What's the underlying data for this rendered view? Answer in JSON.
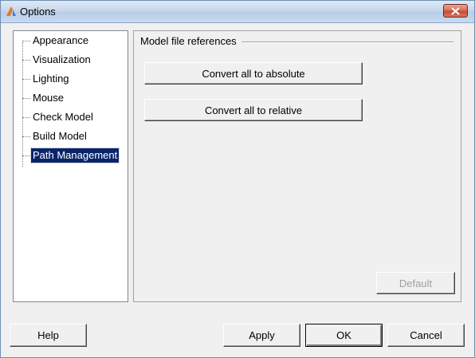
{
  "window": {
    "title": "Options",
    "close_icon": "close-icon"
  },
  "sidebar": {
    "items": [
      {
        "label": "Appearance",
        "selected": false
      },
      {
        "label": "Visualization",
        "selected": false
      },
      {
        "label": "Lighting",
        "selected": false
      },
      {
        "label": "Mouse",
        "selected": false
      },
      {
        "label": "Check Model",
        "selected": false
      },
      {
        "label": "Build Model",
        "selected": false
      },
      {
        "label": "Path Management",
        "selected": true
      }
    ]
  },
  "main": {
    "group_title": "Model file references",
    "convert_absolute_label": "Convert all to absolute",
    "convert_relative_label": "Convert all to relative",
    "default_label": "Default"
  },
  "footer": {
    "help_label": "Help",
    "apply_label": "Apply",
    "ok_label": "OK",
    "cancel_label": "Cancel"
  },
  "colors": {
    "selection_bg": "#0a246a",
    "window_bg": "#f0f0f0",
    "close_button": "#c74b31"
  }
}
